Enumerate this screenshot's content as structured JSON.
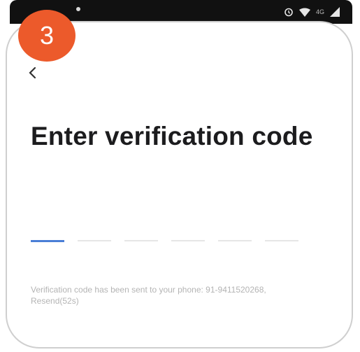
{
  "step": {
    "number": "3",
    "color": "#ec5a2b"
  },
  "status_bar": {
    "network": "4G"
  },
  "header": {
    "back_icon": "chevron-left-icon"
  },
  "title": "Enter verification code",
  "code_input": {
    "length": 6,
    "active_index": 0,
    "active_color": "#4a7ed6",
    "values": [
      "",
      "",
      "",
      "",
      "",
      ""
    ]
  },
  "info": {
    "message": "Verification code has been sent to your phone: 91-9411520268,",
    "resend": "Resend(52s)"
  }
}
